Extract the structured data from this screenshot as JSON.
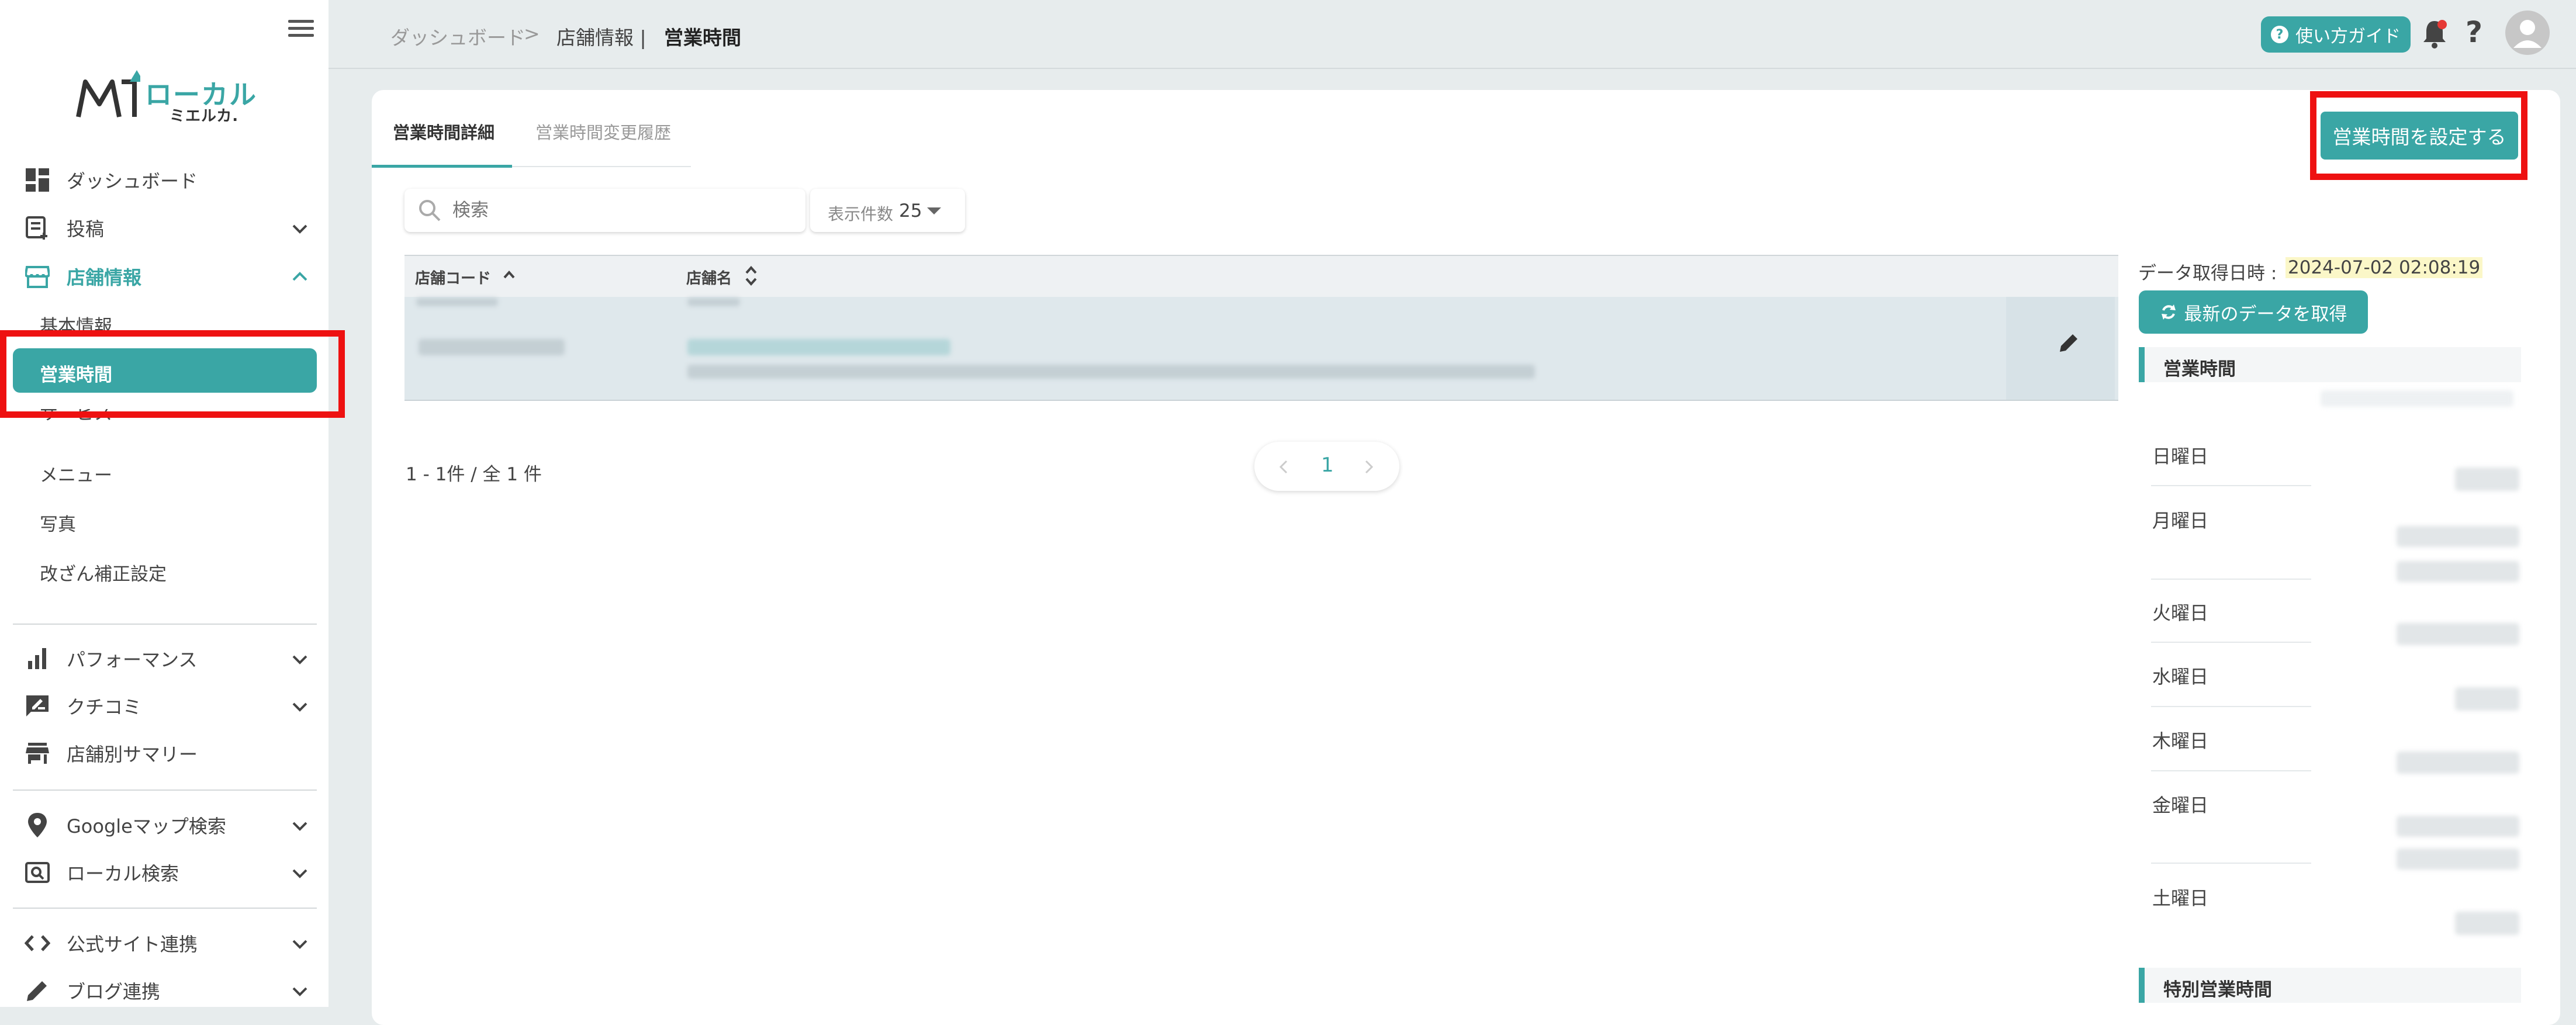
{
  "sidebar": {
    "logo_text": "ローカル",
    "logo_sub": "ミエルカ.",
    "items": [
      {
        "label": "ダッシュボード"
      },
      {
        "label": "投稿"
      },
      {
        "label": "店舗情報"
      },
      {
        "label": "パフォーマンス"
      },
      {
        "label": "クチコミ"
      },
      {
        "label": "店舗別サマリー"
      },
      {
        "label": "Googleマップ検索"
      },
      {
        "label": "ローカル検索"
      },
      {
        "label": "公式サイト連携"
      },
      {
        "label": "ブログ連携"
      }
    ],
    "subitems": [
      {
        "label": "基本情報"
      },
      {
        "label": "営業時間"
      },
      {
        "label": "サービス"
      },
      {
        "label": "メニュー"
      },
      {
        "label": "写真"
      },
      {
        "label": "改ざん補正設定"
      }
    ]
  },
  "header": {
    "breadcrumb_root": "ダッシュボード",
    "breadcrumb_sep": ">",
    "breadcrumb_parent": "店舗情報 |",
    "breadcrumb_current": "営業時間",
    "guide_label": "使い方ガイド",
    "guide_mark": "?",
    "help_mark": "?"
  },
  "main": {
    "tabs": [
      {
        "label": "営業時間詳細"
      },
      {
        "label": "営業時間変更履歴"
      }
    ],
    "set_button": "営業時間を設定する",
    "search_placeholder": "検索",
    "perpage_label": "表示件数",
    "perpage_value": "25",
    "columns": [
      {
        "label": "店舗コード"
      },
      {
        "label": "店舗名"
      }
    ],
    "range_text": "1 - 1件 / 全 1 件",
    "page": "1"
  },
  "panel": {
    "fetched_label": "データ取得日時 :",
    "fetched_value": "2024-07-02 02:08:19",
    "refresh_button": "最新のデータを取得",
    "hours_title": "営業時間",
    "days": [
      "日曜日",
      "月曜日",
      "火曜日",
      "水曜日",
      "木曜日",
      "金曜日",
      "土曜日"
    ],
    "special_title": "特別営業時間"
  },
  "colors": {
    "accent": "#3aa6a5",
    "highlight": "#ee1111"
  }
}
